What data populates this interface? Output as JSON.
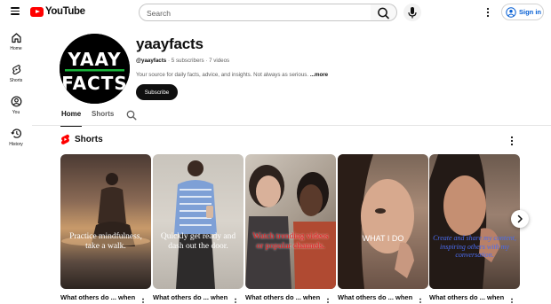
{
  "header": {
    "logo_text": "YouTube",
    "search_placeholder": "Search",
    "signin_label": "Sign in",
    "icons": [
      "menu-icon",
      "youtube-logo",
      "search-icon",
      "mic-icon",
      "more-vert-icon",
      "account-circle-icon"
    ]
  },
  "sidebar": {
    "items": [
      {
        "label": "Home",
        "icon": "home-icon"
      },
      {
        "label": "Shorts",
        "icon": "shorts-icon"
      },
      {
        "label": "You",
        "icon": "you-icon"
      },
      {
        "label": "History",
        "icon": "history-icon"
      }
    ]
  },
  "channel": {
    "avatar_lines": [
      "YAAY",
      "FACTS"
    ],
    "name": "yaayfacts",
    "handle": "@yaayfacts",
    "subscribers": "5 subscribers",
    "videos": "7 videos",
    "separator": "·",
    "description": "Your source for daily facts, advice, and insights. Not always as serious.",
    "more_label": "...more",
    "subscribe_label": "Subscribe"
  },
  "tabs": [
    {
      "label": "Home",
      "active": true
    },
    {
      "label": "Shorts",
      "active": false
    }
  ],
  "shorts_section": {
    "title": "Shorts",
    "cards": [
      {
        "overlay": "Practice mindfulness, take a walk.",
        "title": "What others do ... when",
        "overlay_color": "#ffffff"
      },
      {
        "overlay": "Quickly get ready and dash out the door.",
        "title": "What others do ... when",
        "overlay_color": "#ffffff"
      },
      {
        "overlay": "Watch trending videos or popular channels.",
        "title": "What others do ... when",
        "overlay_color": "#e8171a"
      },
      {
        "overlay": "WHAT I DO",
        "title": "What others do ... when",
        "overlay_color": "#ffffff"
      },
      {
        "overlay": "Create and share my content, inspiring others with my conversation.",
        "title": "What others do ... when",
        "overlay_color": "#4a6cf0"
      }
    ]
  },
  "colors": {
    "brand_red": "#ff0000",
    "link_blue": "#065fd4",
    "text_primary": "#0f0f0f",
    "text_secondary": "#606060",
    "avatar_accent": "#19b53a"
  }
}
